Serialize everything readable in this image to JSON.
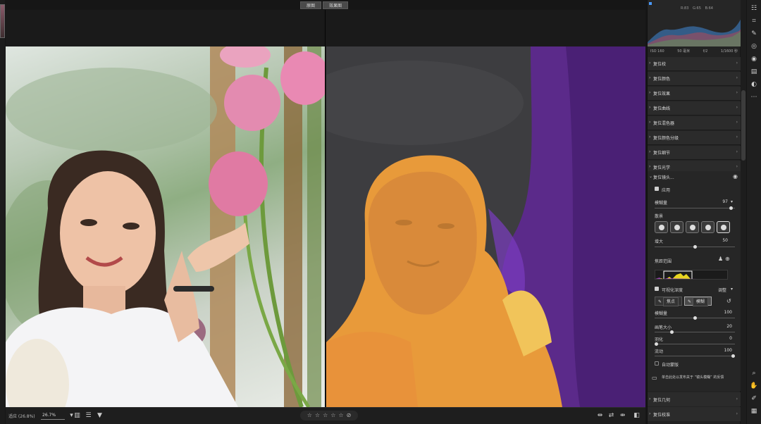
{
  "compare": {
    "before_label": "原图",
    "after_label": "效果图"
  },
  "bottombar": {
    "fit_label": "适应 (26.8%)",
    "zoom_value": "26.7%",
    "stars": [
      "☆",
      "☆",
      "☆",
      "☆",
      "☆"
    ],
    "stars_clear": "⊘",
    "rating": 0
  },
  "histogram": {
    "readout": "R:83  G:65  B:64",
    "exif": [
      "ISO 160",
      "50 毫米",
      "f/2",
      "1/1600 秒"
    ]
  },
  "sections": [
    {
      "label": "复位校"
    },
    {
      "label": "复位颜色"
    },
    {
      "label": "复位效果"
    },
    {
      "label": "复位曲线"
    },
    {
      "label": "复位混色器"
    },
    {
      "label": "复位颜色分级"
    },
    {
      "label": "复位细节"
    },
    {
      "label": "复位光学"
    }
  ],
  "lens": {
    "title": "复位镜头...",
    "apply_label": "应用",
    "blur_label": "模糊量",
    "blur_value": "97",
    "blur_level": 0.97,
    "bokeh_label": "散景",
    "boost_label": "增大",
    "boost_value": "50",
    "boost_level": 0.5,
    "focus_range_label": "焦距范围",
    "visualize_label": "可视化深度",
    "adjust_label": "调整",
    "subtract_label": "焦点",
    "add_label": "模糊",
    "amount_label": "模糊量",
    "amount_value": "100",
    "amount_level": 0.5,
    "brush_size_label": "画笔大小",
    "brush_size_value": "20",
    "brush_size_level": 0.2,
    "feather_label": "羽化",
    "feather_value": "0",
    "feather_level": 0.0,
    "flow_label": "流动",
    "flow_value": "100",
    "flow_level": 1.0,
    "auto_mask_label": "自动蒙版",
    "tip": "单击此处以发布关于 “镜头模糊” 的反馈"
  },
  "bottom_sections": [
    {
      "label": "复位几何"
    },
    {
      "label": "复位校准"
    }
  ]
}
